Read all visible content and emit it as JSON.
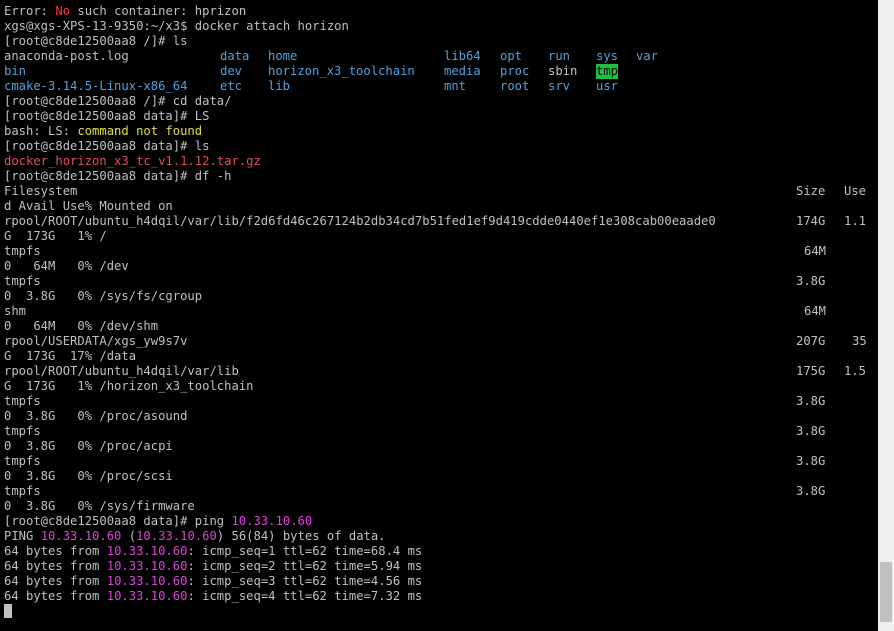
{
  "theme": {
    "background": "#000000",
    "foreground": "#c0c0c0",
    "directory": "#4fa3e0",
    "archive": "#e0505a",
    "error_word": "#ff3030",
    "executable_dir_bg": "#20c040",
    "warning": "#e0e040",
    "ip": "#e040e0"
  },
  "terminal": {
    "l1": {
      "a": "Error: ",
      "b": "No",
      "c": " such container: hprizon"
    },
    "l2": "xgs@xgs-XPS-13-9350:~/x3$ docker attach horizon",
    "l3": "[root@c8de12500aa8 /]# ls",
    "ls": {
      "anaconda": "anaconda-post.log",
      "bin": "bin",
      "cmake": "cmake-3.14.5-Linux-x86_64",
      "data": "data",
      "dev": "dev",
      "etc": "etc",
      "home": "home",
      "horizon": "horizon_x3_toolchain",
      "lib": "lib",
      "lib64": "lib64",
      "media": "media",
      "mnt": "mnt",
      "opt": "opt",
      "proc": "proc",
      "root": "root",
      "run": "run",
      "sbin": "sbin",
      "srv": "srv",
      "sys": "sys",
      "tmp": "tmp",
      "usr": "usr",
      "var": "var"
    },
    "l7": "[root@c8de12500aa8 /]# cd data/",
    "l8": "[root@c8de12500aa8 data]# LS",
    "l9": {
      "a": "bash: LS: ",
      "b": "command not found"
    },
    "l10": "[root@c8de12500aa8 data]# ls",
    "l11": "docker_horizon_x3_tc_v1.1.12.tar.gz",
    "l12": "[root@c8de12500aa8 data]# df -h",
    "df": {
      "h1": "Filesystem",
      "h1_size": "Size",
      "h1_use": "Use",
      "h2": "d Avail Use% Mounted on",
      "r1a": "rpool/ROOT/ubuntu_h4dqil/var/lib/f2d6fd46c267124b2db34cd7b51fed1ef9d419cdde0440ef1e308cab00eaade0",
      "r1size": "174G",
      "r1use": "1.1",
      "r1b": "G  173G   1% /",
      "r2a": "tmpfs",
      "r2size": "64M",
      "r2b": "0   64M   0% /dev",
      "r3a": "tmpfs",
      "r3size": "3.8G",
      "r3b": "0  3.8G   0% /sys/fs/cgroup",
      "r4a": "shm",
      "r4size": "64M",
      "r4b": "0   64M   0% /dev/shm",
      "r5a": "rpool/USERDATA/xgs_yw9s7v",
      "r5size": "207G",
      "r5use": "35",
      "r5b": "G  173G  17% /data",
      "r6a": "rpool/ROOT/ubuntu_h4dqil/var/lib",
      "r6size": "175G",
      "r6use": "1.5",
      "r6b": "G  173G   1% /horizon_x3_toolchain",
      "r7a": "tmpfs",
      "r7size": "3.8G",
      "r7b": "0  3.8G   0% /proc/asound",
      "r8a": "tmpfs",
      "r8size": "3.8G",
      "r8b": "0  3.8G   0% /proc/acpi",
      "r9a": "tmpfs",
      "r9size": "3.8G",
      "r9b": "0  3.8G   0% /proc/scsi",
      "r10a": "tmpfs",
      "r10size": "3.8G",
      "r10b": "0  3.8G   0% /sys/firmware"
    },
    "ping": {
      "cmd_prefix": "[root@c8de12500aa8 data]# ping ",
      "ip": "10.33.10.60",
      "hdr_a": "PING ",
      "hdr_b": " (",
      "hdr_c": ") 56(84) bytes of data.",
      "reply_prefix": "64 bytes from ",
      "r1": ": icmp_seq=1 ttl=62 time=68.4 ms",
      "r2": ": icmp_seq=2 ttl=62 time=5.94 ms",
      "r3": ": icmp_seq=3 ttl=62 time=4.56 ms",
      "r4": ": icmp_seq=4 ttl=62 time=7.32 ms"
    }
  }
}
